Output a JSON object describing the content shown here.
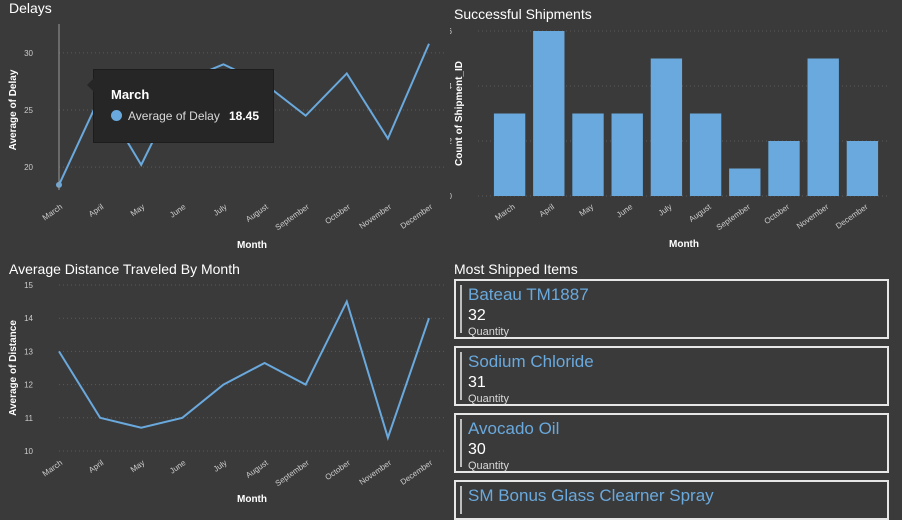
{
  "colors": {
    "background": "#3a3a3a",
    "series": "#6aa9dd",
    "grid": "#5a5a5a",
    "text": "#ffffff",
    "tick": "#cccccc"
  },
  "delays": {
    "title": "Delays",
    "tooltip": {
      "month": "March",
      "label": "Average of Delay",
      "value": "18.45"
    },
    "chart_data": {
      "type": "line",
      "xlabel": "Month",
      "ylabel": "Average of Delay",
      "categories": [
        "March",
        "April",
        "May",
        "June",
        "July",
        "August",
        "September",
        "October",
        "November",
        "December"
      ],
      "values": [
        18.45,
        26.2,
        20.2,
        27.5,
        29.0,
        27.3,
        24.5,
        28.2,
        22.5,
        30.8
      ],
      "yticks": [
        20,
        25,
        30
      ],
      "ylim": [
        18,
        32
      ]
    }
  },
  "shipments": {
    "title": "Successful Shipments",
    "chart_data": {
      "type": "bar",
      "xlabel": "Month",
      "ylabel": "Count of Shipment_ID",
      "categories": [
        "March",
        "April",
        "May",
        "June",
        "July",
        "August",
        "September",
        "October",
        "November",
        "December"
      ],
      "values": [
        3,
        6,
        3,
        3,
        5,
        3,
        1,
        2,
        5,
        2
      ],
      "yticks": [
        0,
        2,
        4,
        6
      ],
      "ylim": [
        0,
        6
      ]
    }
  },
  "distance": {
    "title": "Average Distance Traveled By Month",
    "chart_data": {
      "type": "line",
      "xlabel": "Month",
      "ylabel": "Average of Distance",
      "categories": [
        "March",
        "April",
        "May",
        "June",
        "July",
        "August",
        "September",
        "October",
        "November",
        "December"
      ],
      "values": [
        13.0,
        11.0,
        10.7,
        11.0,
        12.0,
        12.65,
        12.0,
        14.5,
        10.4,
        14.0
      ],
      "yticks": [
        10,
        11,
        12,
        13,
        14,
        15
      ],
      "ylim": [
        10,
        15
      ]
    }
  },
  "items": {
    "title": "Most Shipped Items",
    "list": [
      {
        "name": "Bateau TM1887",
        "value": "32",
        "label": "Quantity"
      },
      {
        "name": "Sodium Chloride",
        "value": "31",
        "label": "Quantity"
      },
      {
        "name": "Avocado Oil",
        "value": "30",
        "label": "Quantity"
      },
      {
        "name": "SM Bonus Glass Clearner Spray",
        "value": "",
        "label": ""
      }
    ]
  }
}
